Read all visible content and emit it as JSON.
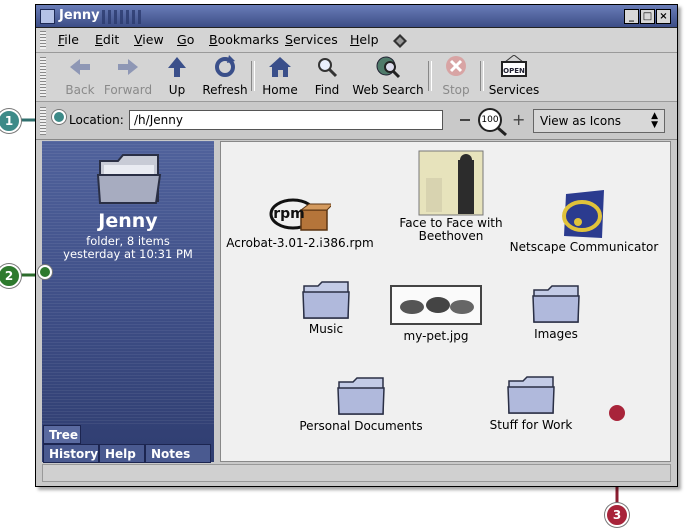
{
  "window": {
    "title": "Jenny"
  },
  "menubar": {
    "items": [
      "File",
      "Edit",
      "View",
      "Go",
      "Bookmarks",
      "Services",
      "Help"
    ]
  },
  "toolbar": {
    "back": "Back",
    "forward": "Forward",
    "up": "Up",
    "refresh": "Refresh",
    "home": "Home",
    "find": "Find",
    "web_search": "Web Search",
    "stop": "Stop",
    "services": "Services"
  },
  "location": {
    "label": "Location:",
    "value": "/h/Jenny",
    "zoom": "100",
    "view_mode": "View as Icons"
  },
  "sidebar": {
    "folder_name": "Jenny",
    "info_line1": "folder, 8 items",
    "info_line2": "yesterday at 10:31 PM",
    "tabs": [
      "Tree",
      "History",
      "Help",
      "Notes"
    ]
  },
  "files": [
    {
      "name": "Acrobat-3.01-2.i386.rpm",
      "icon": "rpm-package-icon"
    },
    {
      "name": "Face to Face with Beethoven",
      "icon": "album-cover-thumbnail"
    },
    {
      "name": "Netscape Communicator",
      "icon": "netscape-icon"
    },
    {
      "name": "Music",
      "icon": "folder-icon"
    },
    {
      "name": "my-pet.jpg",
      "icon": "image-thumbnail"
    },
    {
      "name": "Images",
      "icon": "folder-icon"
    },
    {
      "name": "Personal Documents",
      "icon": "folder-icon"
    },
    {
      "name": "Stuff for Work",
      "icon": "folder-icon"
    }
  ],
  "callouts": {
    "c1": "1",
    "c2": "2",
    "c3": "3"
  },
  "colors": {
    "callout_teal": "#3d8a88",
    "callout_green": "#2e7a2e",
    "callout_red": "#a8243a",
    "sidebar_blue": "#44548c"
  }
}
